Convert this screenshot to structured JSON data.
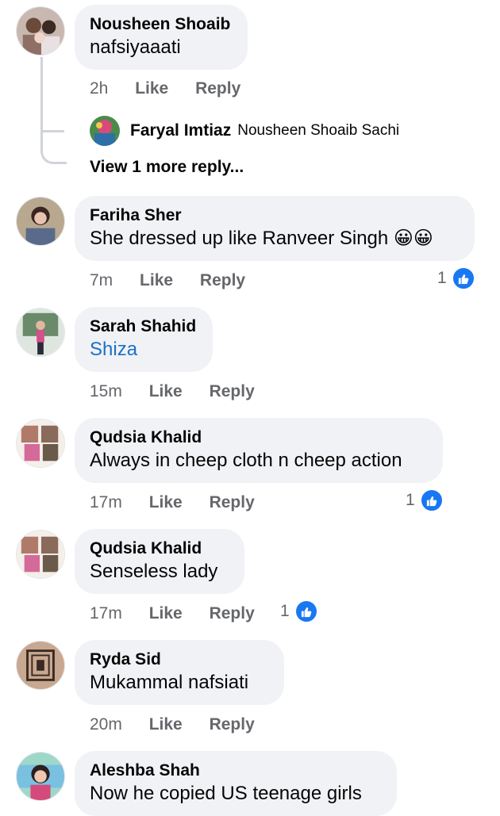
{
  "comments": [
    {
      "name": "Nousheen Shoaib",
      "text": "nafsiyaaati",
      "time": "2h",
      "like": "Like",
      "reply": "Reply"
    },
    {
      "name": "Fariha Sher",
      "text": "She dressed up like Ranveer Singh 😀😀",
      "time": "7m",
      "like": "Like",
      "reply": "Reply",
      "reactions": "1"
    },
    {
      "name": "Sarah Shahid",
      "text": "Shiza",
      "time": "15m",
      "like": "Like",
      "reply": "Reply"
    },
    {
      "name": "Qudsia Khalid",
      "text": "Always in cheep cloth n cheep action",
      "time": "17m",
      "like": "Like",
      "reply": "Reply",
      "reactions": "1"
    },
    {
      "name": "Qudsia Khalid",
      "text": "Senseless lady",
      "time": "17m",
      "like": "Like",
      "reply": "Reply",
      "reactions": "1"
    },
    {
      "name": "Ryda Sid",
      "text": "Mukammal nafsiati",
      "time": "20m",
      "like": "Like",
      "reply": "Reply"
    },
    {
      "name": "Aleshba Shah",
      "text": "Now he copied US teenage girls"
    }
  ],
  "reply_preview": {
    "name": "Faryal Imtiaz",
    "text": "Nousheen Shoaib Sachi"
  },
  "view_more": "View 1 more reply...",
  "colors": {
    "bubble": "#f0f2f5",
    "like_blue": "#1877f2",
    "meta_grey": "#65676b",
    "link_blue": "#1f6fc6"
  }
}
